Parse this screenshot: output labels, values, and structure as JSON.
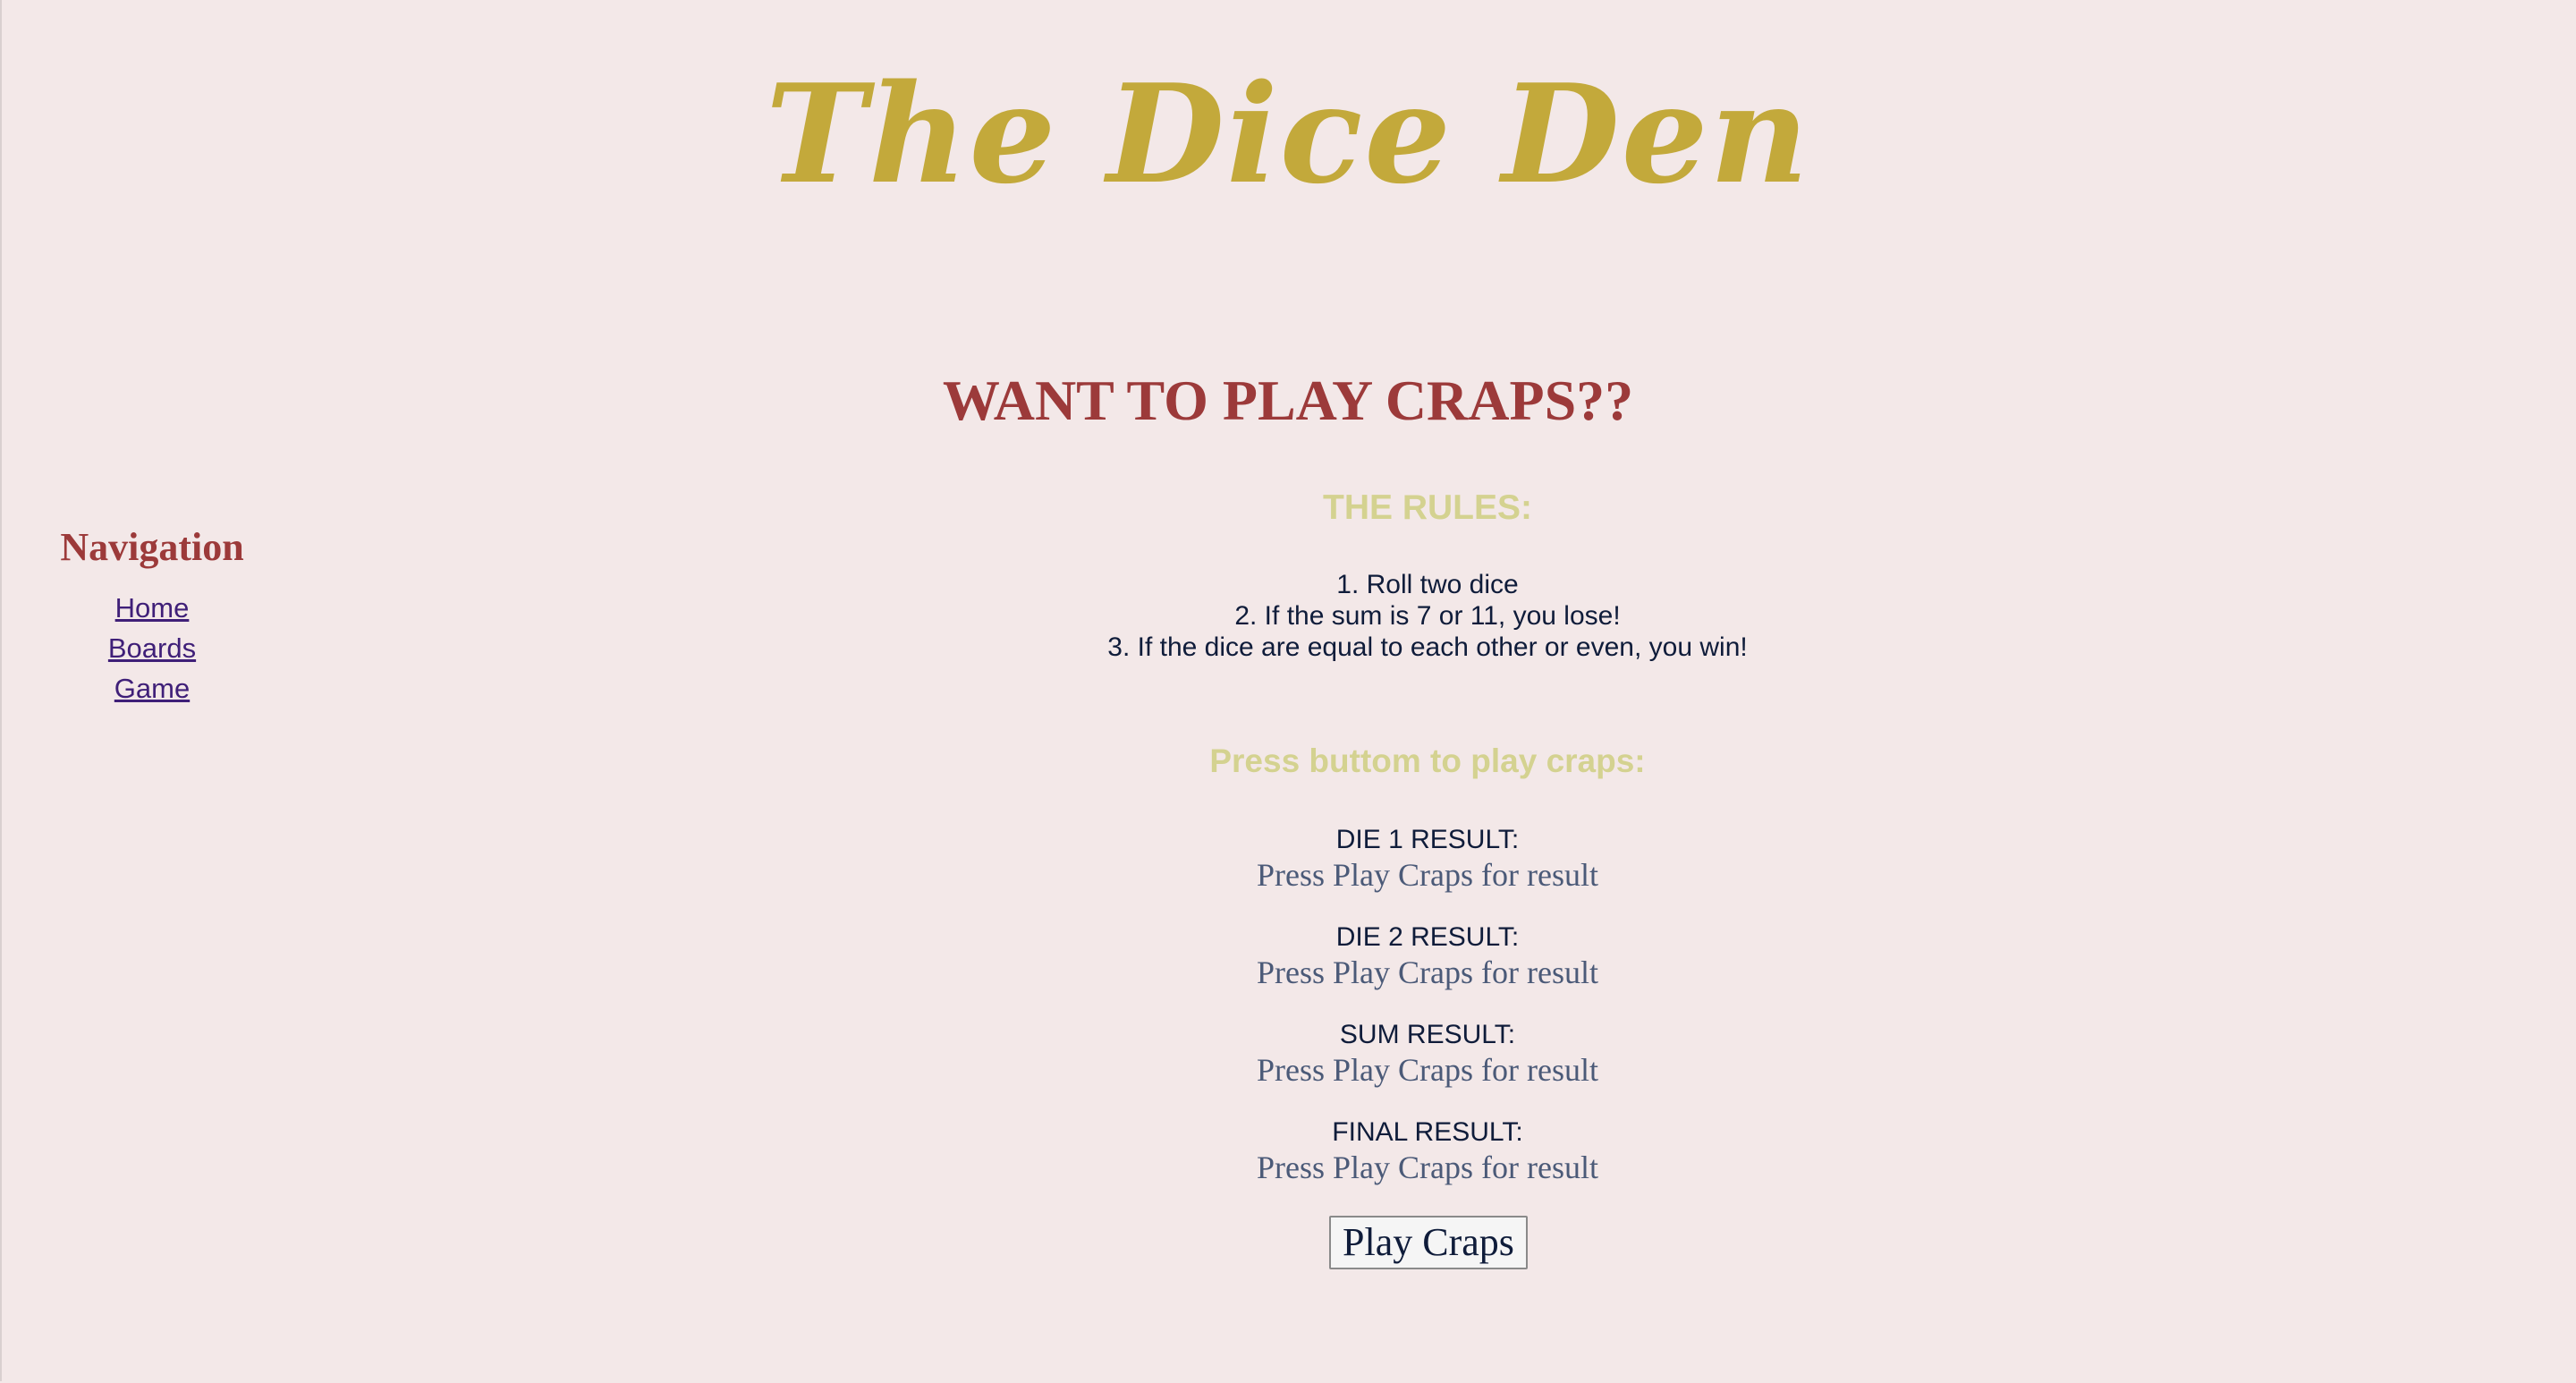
{
  "site": {
    "title": "The Dice Den"
  },
  "nav": {
    "heading": "Navigation",
    "items": [
      {
        "label": "Home"
      },
      {
        "label": "Boards"
      },
      {
        "label": "Game"
      }
    ]
  },
  "main": {
    "headline": "WANT TO PLAY CRAPS??",
    "rules_heading": "THE RULES:",
    "rules": [
      "1. Roll two dice",
      "2. If the sum is 7 or 11, you lose!",
      "3. If the dice are equal to each other or even, you win!"
    ],
    "press_heading": "Press buttom to play craps:",
    "results": [
      {
        "label": "DIE 1 RESULT:",
        "value": "Press Play Craps for result"
      },
      {
        "label": "DIE 2 RESULT:",
        "value": "Press Play Craps for result"
      },
      {
        "label": "SUM RESULT:",
        "value": "Press Play Craps for result"
      },
      {
        "label": "FINAL RESULT:",
        "value": "Press Play Craps for result"
      }
    ],
    "button_label": "Play Craps"
  },
  "colors": {
    "background": "#f3e8e8",
    "title": "#c3a93b",
    "headline": "#9c3a3a",
    "subheading": "#d4d290",
    "link": "#3f1f78",
    "text": "#0f1c3a",
    "result_value": "#4b5a78"
  }
}
